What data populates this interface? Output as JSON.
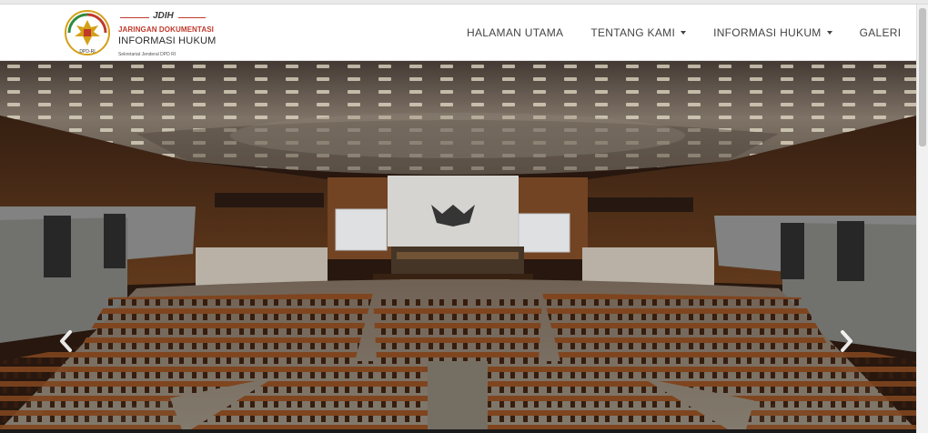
{
  "brand": {
    "jdih": "JDIH",
    "line1": "JARINGAN DOKUMENTASI",
    "line2": "INFORMASI HUKUM",
    "line3": "Sekretariat Jenderal DPD RI",
    "emblem_text": "DPD-RI"
  },
  "nav": {
    "items": [
      {
        "label": "HALAMAN UTAMA",
        "dropdown": false
      },
      {
        "label": "TENTANG KAMI",
        "dropdown": true
      },
      {
        "label": "INFORMASI HUKUM",
        "dropdown": true
      },
      {
        "label": "GALERI",
        "dropdown": false
      }
    ]
  },
  "carousel": {
    "slide_alt": "Ruang sidang paripurna",
    "prev_icon": "chevron-left-icon",
    "next_icon": "chevron-right-icon"
  },
  "colors": {
    "brand_red": "#c0392b",
    "nav_text": "#444444",
    "wood": "#5a3418",
    "ceiling": "#6f6257"
  }
}
